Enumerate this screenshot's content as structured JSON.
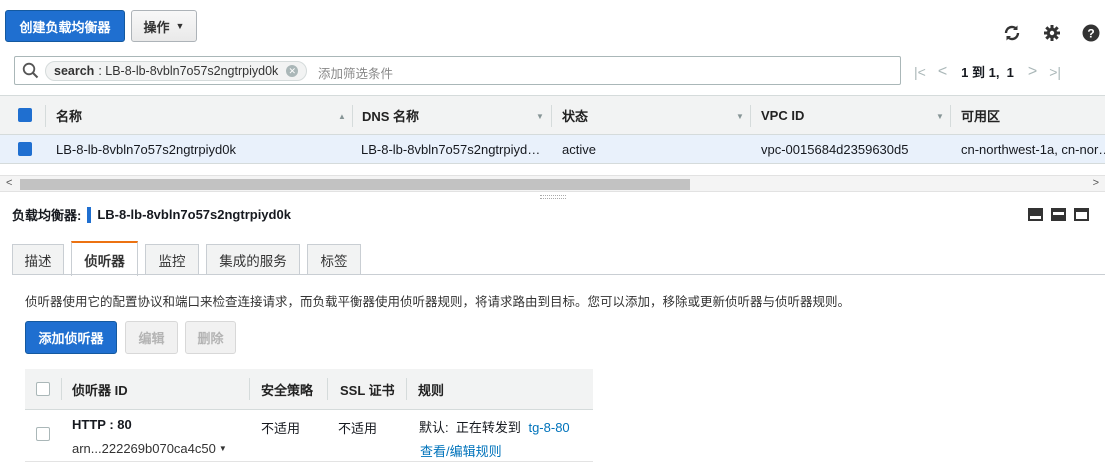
{
  "toolbar": {
    "create_label": "创建负载均衡器",
    "actions_label": "操作",
    "icons": [
      "refresh-icon",
      "gear-icon",
      "help-icon"
    ]
  },
  "filter": {
    "token_key": "search",
    "token_value": ": LB-8-lb-8vbln7o57s2ngtrpiyd0k",
    "placeholder": "添加筛选条件"
  },
  "pager": {
    "text": "1 到 1,  1"
  },
  "grid": {
    "columns": [
      "名称",
      "DNS 名称",
      "状态",
      "VPC ID",
      "可用区"
    ],
    "row": {
      "name": "LB-8-lb-8vbln7o57s2ngtrpiyd0k",
      "dns": "LB-8-lb-8vbln7o57s2ngtrpiyd…",
      "status": "active",
      "vpc": "vpc-0015684d2359630d5",
      "az": "cn-northwest-1a, cn-nor…"
    }
  },
  "detail": {
    "label": "负载均衡器:",
    "name": "LB-8-lb-8vbln7o57s2ngtrpiyd0k",
    "tabs": [
      "描述",
      "侦听器",
      "监控",
      "集成的服务",
      "标签"
    ],
    "active_tab": "侦听器",
    "description": "侦听器使用它的配置协议和端口来检查连接请求，而负载平衡器使用侦听器规则，将请求路由到目标。您可以添加，移除或更新侦听器与侦听器规则。",
    "buttons": {
      "add": "添加侦听器",
      "edit": "编辑",
      "delete": "删除"
    }
  },
  "listeners": {
    "columns": [
      "侦听器 ID",
      "安全策略",
      "SSL 证书",
      "规则"
    ],
    "row": {
      "protocol": "HTTP : 80",
      "arn": "arn...222269b070ca4c50",
      "policy": "不适用",
      "ssl": "不适用",
      "rule_prefix": "默认:  正在转发到",
      "rule_target": "tg-8-80",
      "rule_link": "查看/编辑规则"
    }
  },
  "colors": {
    "primary": "#1f6fd0",
    "accent_tab": "#ec7211",
    "link": "#0073bb",
    "selected_row": "#e9f1fb"
  }
}
